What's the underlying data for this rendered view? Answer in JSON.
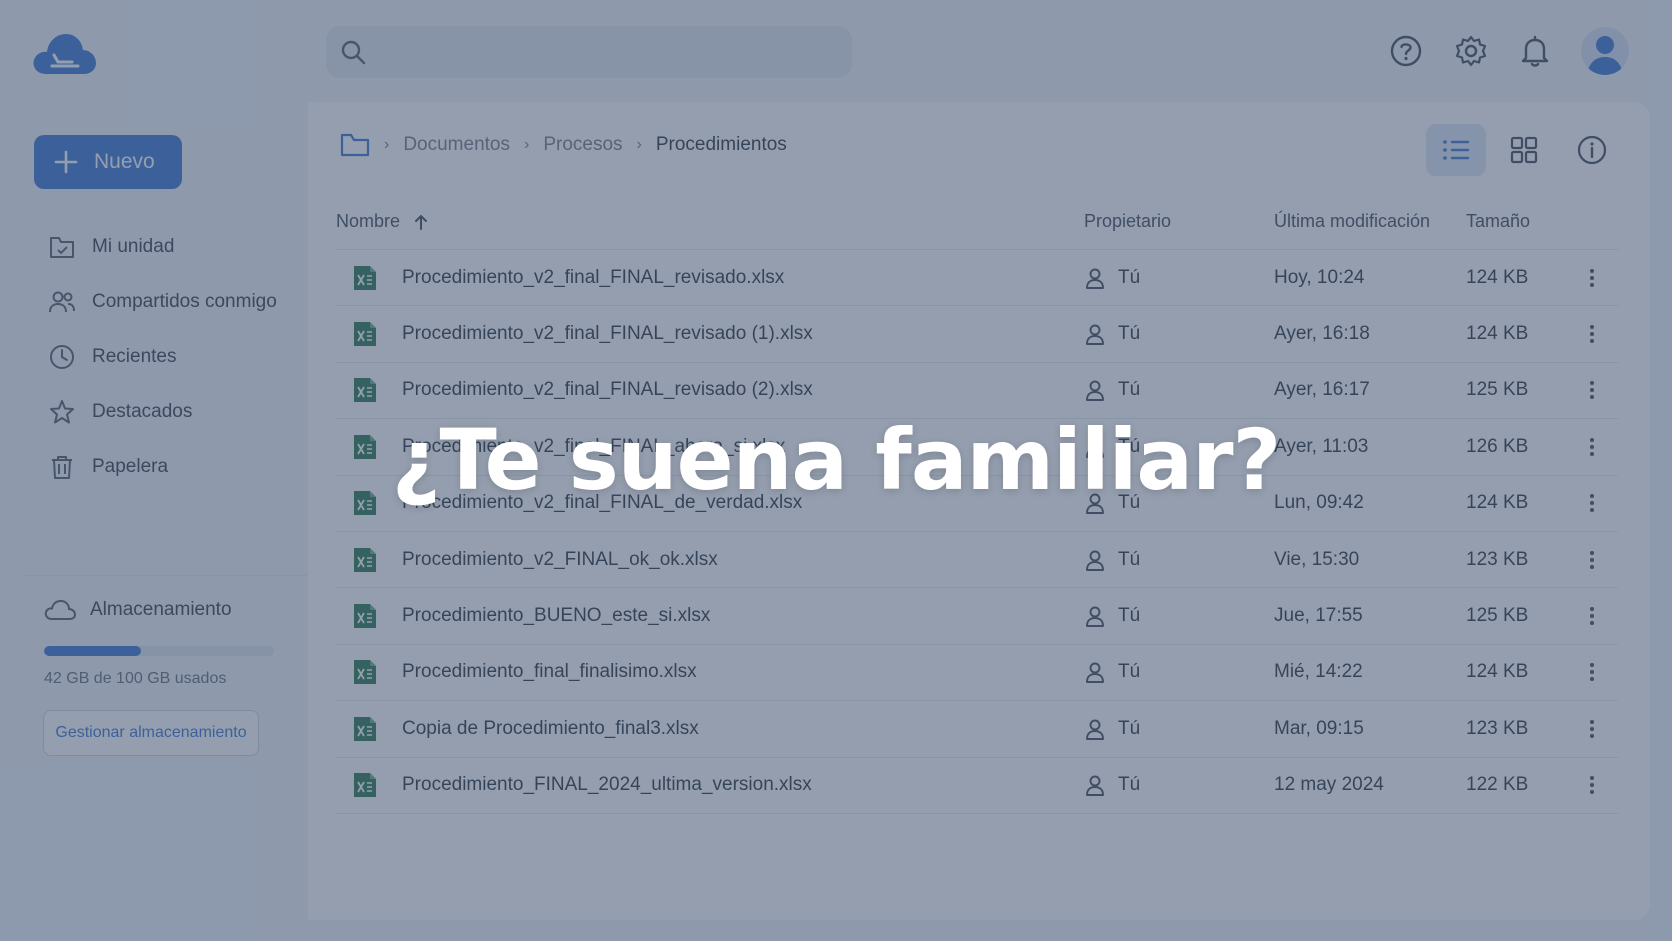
{
  "search": {
    "placeholder": "",
    "value": ""
  },
  "sidebar": {
    "new_label": "Nuevo",
    "items": [
      {
        "label": "Mi unidad",
        "icon": "drive-icon"
      },
      {
        "label": "Compartidos conmigo",
        "icon": "shared-users-icon"
      },
      {
        "label": "Recientes",
        "icon": "clock-icon"
      },
      {
        "label": "Destacados",
        "icon": "star-icon"
      },
      {
        "label": "Papelera",
        "icon": "trash-icon"
      }
    ],
    "storage": {
      "label": "Almacenamiento",
      "usage_text": "42 GB de 100 GB usados",
      "used_fraction": 0.42,
      "manage_label": "Gestionar almacenamiento"
    }
  },
  "breadcrumb": [
    "Documentos",
    "Procesos",
    "Procedimientos"
  ],
  "table": {
    "headers": {
      "name": "Nombre",
      "owner": "Propietario",
      "modified": "Última modificación",
      "size": "Tamaño"
    },
    "rows": [
      {
        "name": "Procedimiento_v2_final_FINAL_revisado.xlsx",
        "owner": "Tú",
        "modified": "Hoy, 10:24",
        "size": "124 KB"
      },
      {
        "name": "Procedimiento_v2_final_FINAL_revisado (1).xlsx",
        "owner": "Tú",
        "modified": "Ayer, 16:18",
        "size": "124 KB"
      },
      {
        "name": "Procedimiento_v2_final_FINAL_revisado (2).xlsx",
        "owner": "Tú",
        "modified": "Ayer, 16:17",
        "size": "125 KB"
      },
      {
        "name": "Procedimiento_v2_final_FINAL_ahora_si.xlsx",
        "owner": "Tú",
        "modified": "Ayer, 11:03",
        "size": "126 KB"
      },
      {
        "name": "Procedimiento_v2_final_FINAL_de_verdad.xlsx",
        "owner": "Tú",
        "modified": "Lun, 09:42",
        "size": "124 KB"
      },
      {
        "name": "Procedimiento_v2_FINAL_ok_ok.xlsx",
        "owner": "Tú",
        "modified": "Vie, 15:30",
        "size": "123 KB"
      },
      {
        "name": "Procedimiento_BUENO_este_si.xlsx",
        "owner": "Tú",
        "modified": "Jue, 17:55",
        "size": "125 KB"
      },
      {
        "name": "Procedimiento_final_finalisimo.xlsx",
        "owner": "Tú",
        "modified": "Mié, 14:22",
        "size": "124 KB"
      },
      {
        "name": "Copia de Procedimiento_final3.xlsx",
        "owner": "Tú",
        "modified": "Mar, 09:15",
        "size": "123 KB"
      },
      {
        "name": "Procedimiento_FINAL_2024_ultima_version.xlsx",
        "owner": "Tú",
        "modified": "12 may 2024",
        "size": "122 KB"
      }
    ]
  },
  "overlay": {
    "headline": "¿Te suena familiar?"
  },
  "colors": {
    "accent": "#2e6fd0",
    "excel_green": "#1e7145",
    "overlay": "#46587380"
  }
}
